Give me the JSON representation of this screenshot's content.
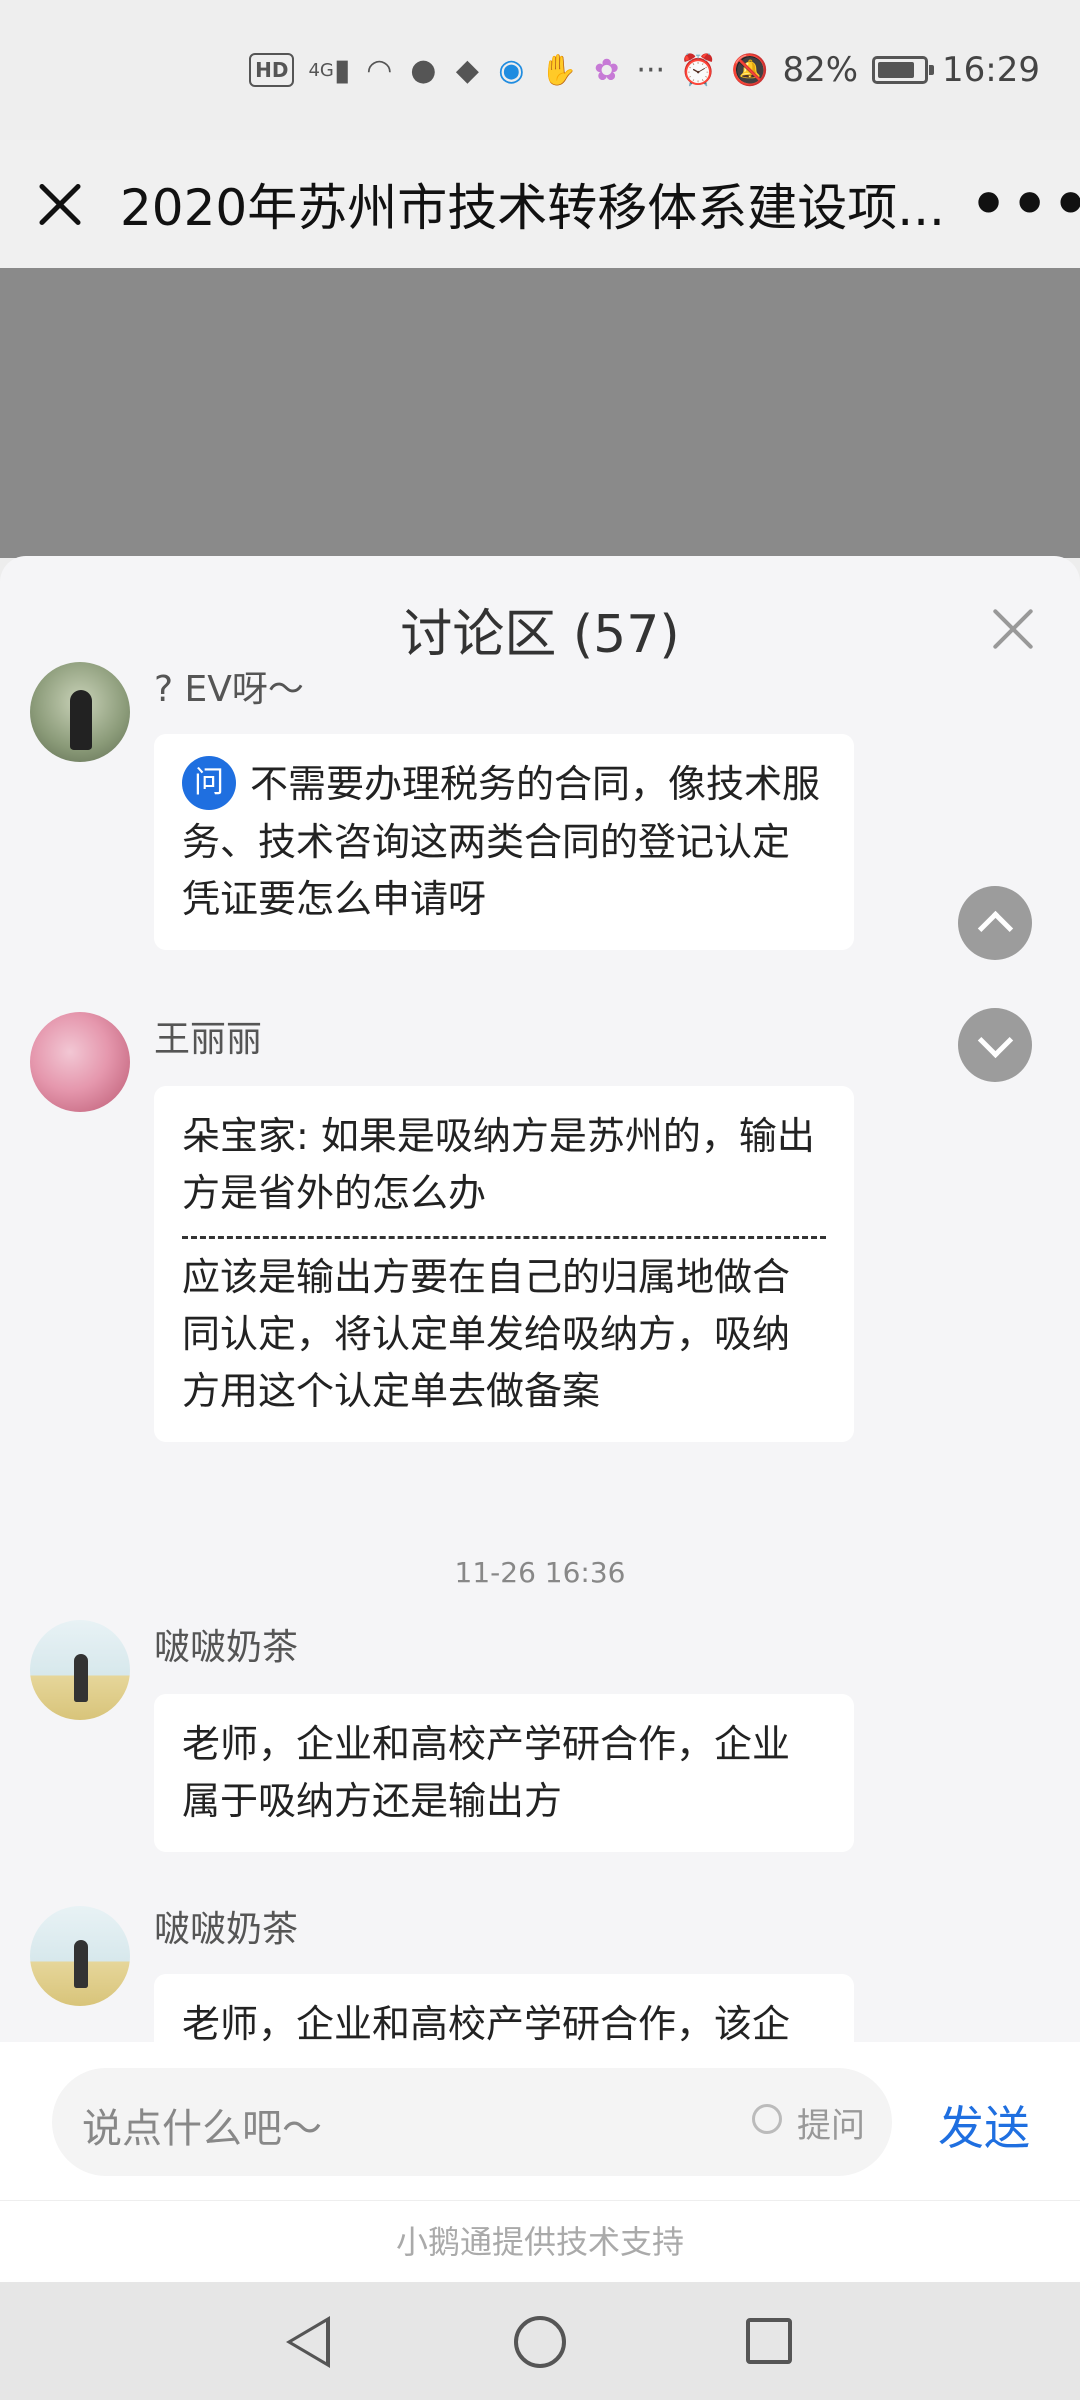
{
  "status_bar": {
    "hd": "HD",
    "signal": "4G",
    "battery_percent": "82%",
    "battery_level": 0.82,
    "time": "16:29",
    "dots": "···"
  },
  "title_bar": {
    "title": "2020年苏州市技术转移体系建设项...",
    "more": "•••"
  },
  "discussion": {
    "title": "讨论区 (57)",
    "messages": [
      {
        "user": "? EV呀～",
        "badge": "问",
        "text": "不需要办理税务的合同，像技术服务、技术咨询这两类合同的登记认定凭证要怎么申请呀"
      },
      {
        "user": "王丽丽",
        "quote": "朵宝家: 如果是吸纳方是苏州的，输出方是省外的怎么办",
        "reply": "应该是输出方要在自己的归属地做合同认定，将认定单发给吸纳方，吸纳方用这个认定单去做备案"
      },
      {
        "user": "啵啵奶茶",
        "text": "老师，企业和高校产学研合作，企业属于吸纳方还是输出方"
      },
      {
        "user": "啵啵奶茶",
        "text": "老师，企业和高校产学研合作，该企"
      }
    ],
    "time_separator": "11-26 16:36"
  },
  "input": {
    "placeholder": "说点什么吧～",
    "ask_label": "提问",
    "send_label": "发送"
  },
  "footer": {
    "powered_by": "小鹅通提供技术支持"
  }
}
